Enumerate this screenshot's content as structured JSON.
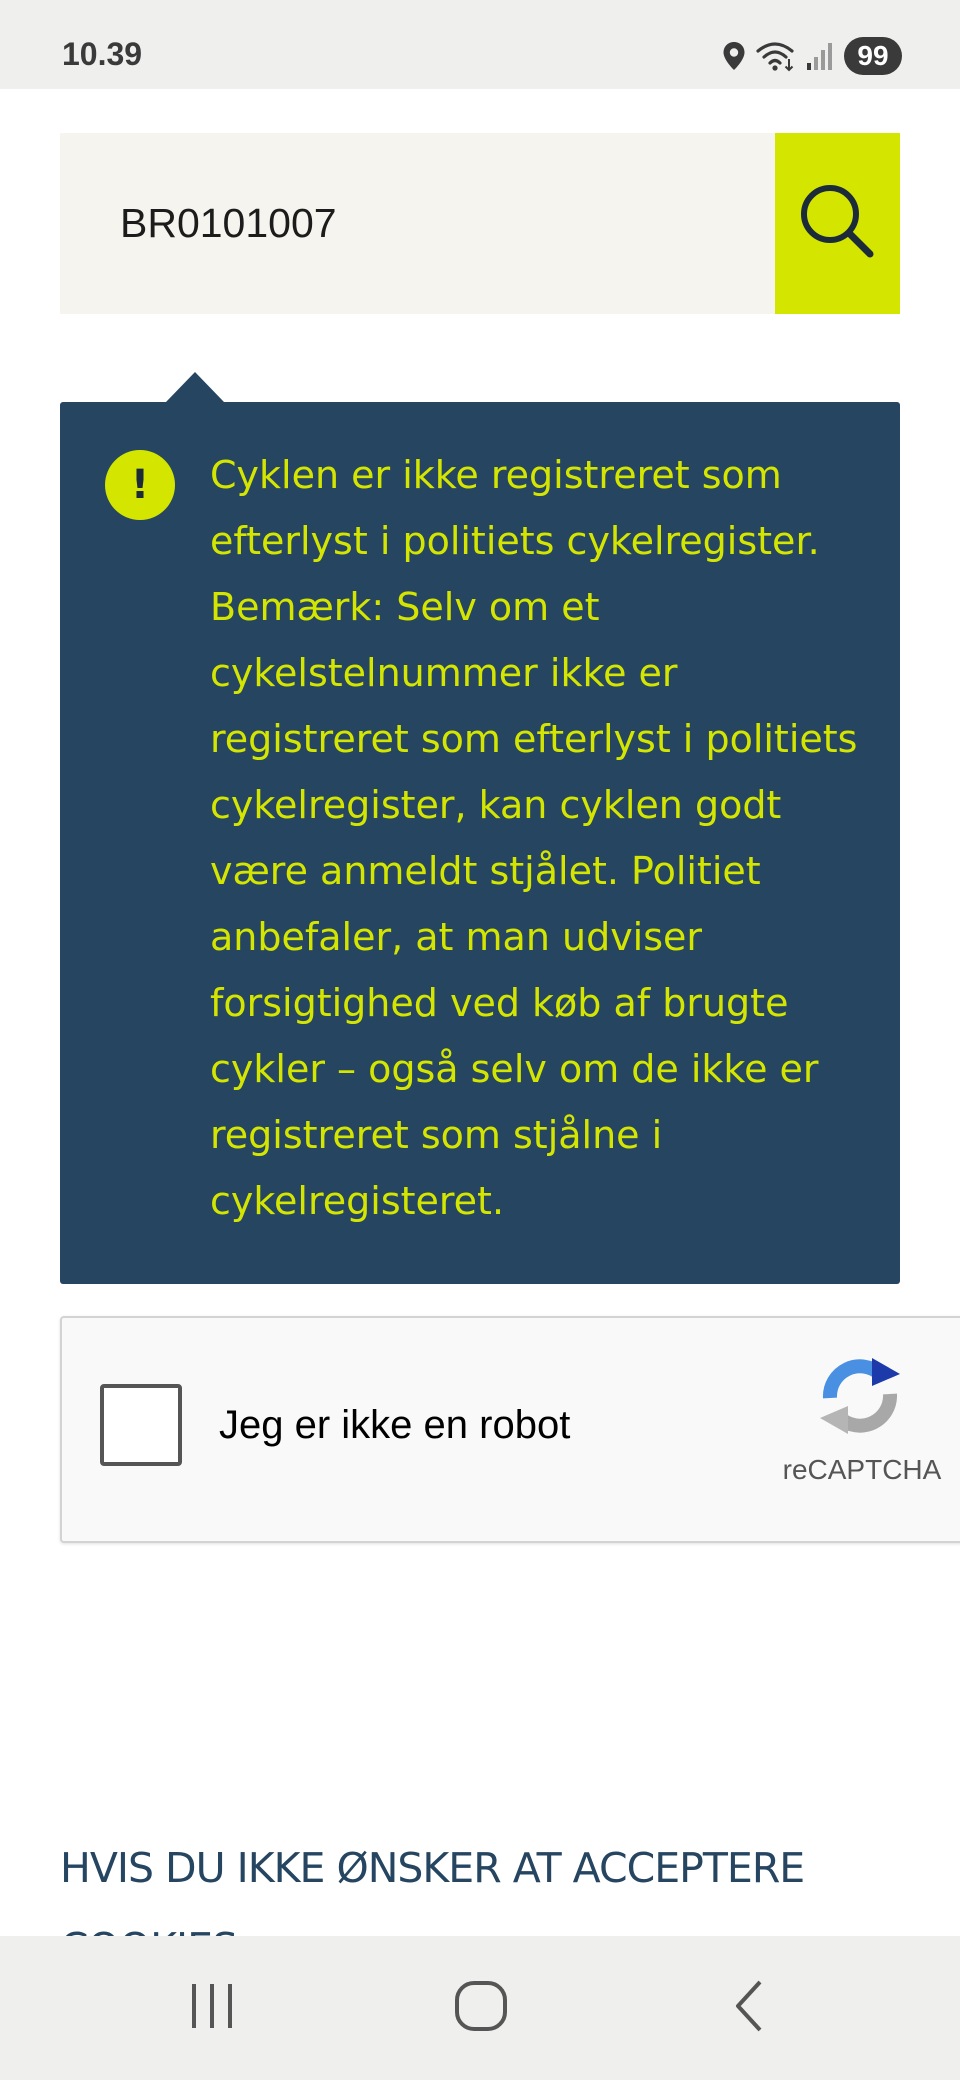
{
  "status_bar": {
    "time": "10.39",
    "battery": "99",
    "icons": [
      "location-icon",
      "wifi-icon",
      "signal-icon"
    ]
  },
  "search": {
    "value": "BR0101007",
    "button_icon": "search-icon"
  },
  "alert": {
    "icon_symbol": "!",
    "message": "Cyklen er ikke registreret som efterlyst i politiets cykelregister. Bemærk: Selv om et cykelstelnummer ikke er registreret som efterlyst i politiets cykelregister, kan cyklen godt være anmeldt stjålet. Politiet anbefaler, at man udviser forsigtighed ved køb af brugte cykler – også selv om de ikke er registreret som stjålne i cykelregisteret."
  },
  "recaptcha": {
    "label": "Jeg er ikke en robot",
    "brand": "reCAPTCHA"
  },
  "cookies": {
    "heading": "HVIS DU IKKE ØNSKER AT ACCEPTERE COOKIES"
  },
  "nav_bar": {
    "buttons": [
      "recent-apps-icon",
      "home-icon",
      "back-icon"
    ]
  },
  "colors": {
    "accent": "#d4e600",
    "alert_background": "#254561",
    "input_background": "#f6f4ee",
    "system_bar": "#efefed"
  }
}
